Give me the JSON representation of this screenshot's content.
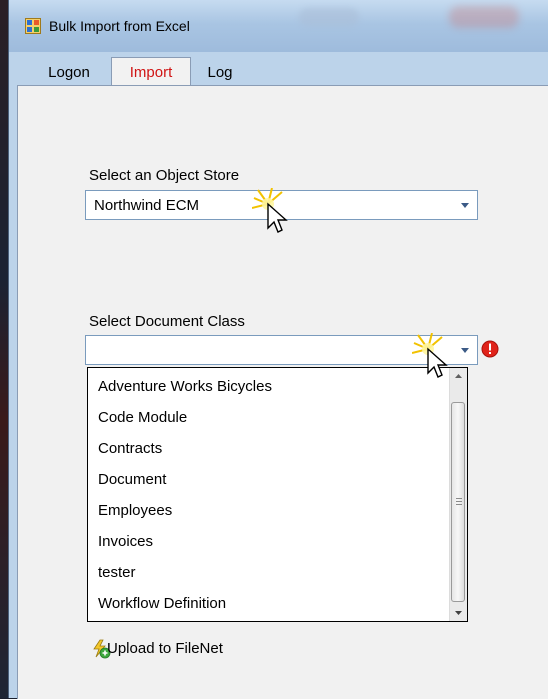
{
  "window": {
    "title": "Bulk Import from Excel",
    "app_icon": "form-window-icon"
  },
  "tabs": [
    {
      "label": "Logon",
      "selected": false
    },
    {
      "label": "Import",
      "selected": true
    },
    {
      "label": "Log",
      "selected": false
    }
  ],
  "object_store": {
    "label": "Select an Object Store",
    "value": "Northwind ECM"
  },
  "document_class": {
    "label": "Select Document Class",
    "value": "",
    "error_icon": "error-icon",
    "options": [
      "Adventure Works Bicycles",
      "Code Module",
      "Contracts",
      "Document",
      "Employees",
      "Invoices",
      "tester",
      "Workflow Definition"
    ]
  },
  "upload": {
    "label": "Upload to FileNet",
    "icon": "upload-lightning-icon"
  },
  "colors": {
    "selected_tab_text": "#d01414",
    "window_frame": "#bcd3ea",
    "panel_background": "#f1f1f1",
    "error_red": "#e0231a"
  }
}
